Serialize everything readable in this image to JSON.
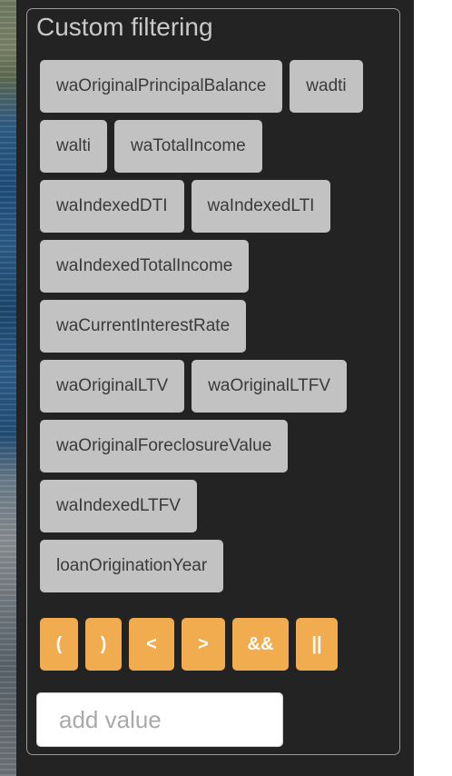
{
  "panel": {
    "title": "Custom filtering"
  },
  "fields": [
    "waOriginalPrincipalBalance",
    "wadti",
    "walti",
    "waTotalIncome",
    "waIndexedDTI",
    "waIndexedLTI",
    "waIndexedTotalIncome",
    "waCurrentInterestRate",
    "waOriginalLTV",
    "waOriginalLTFV",
    "waOriginalForeclosureValue",
    "waIndexedLTFV",
    "loanOriginationYear"
  ],
  "operators": [
    "(",
    ")",
    "<",
    ">",
    "&&",
    "||"
  ],
  "value_input": {
    "placeholder": "add value",
    "value": ""
  },
  "colors": {
    "panel_background": "#232323",
    "field_button": "#c2c2c2",
    "operator_button": "#f0ac4e",
    "title_text": "#c9c9c9"
  }
}
